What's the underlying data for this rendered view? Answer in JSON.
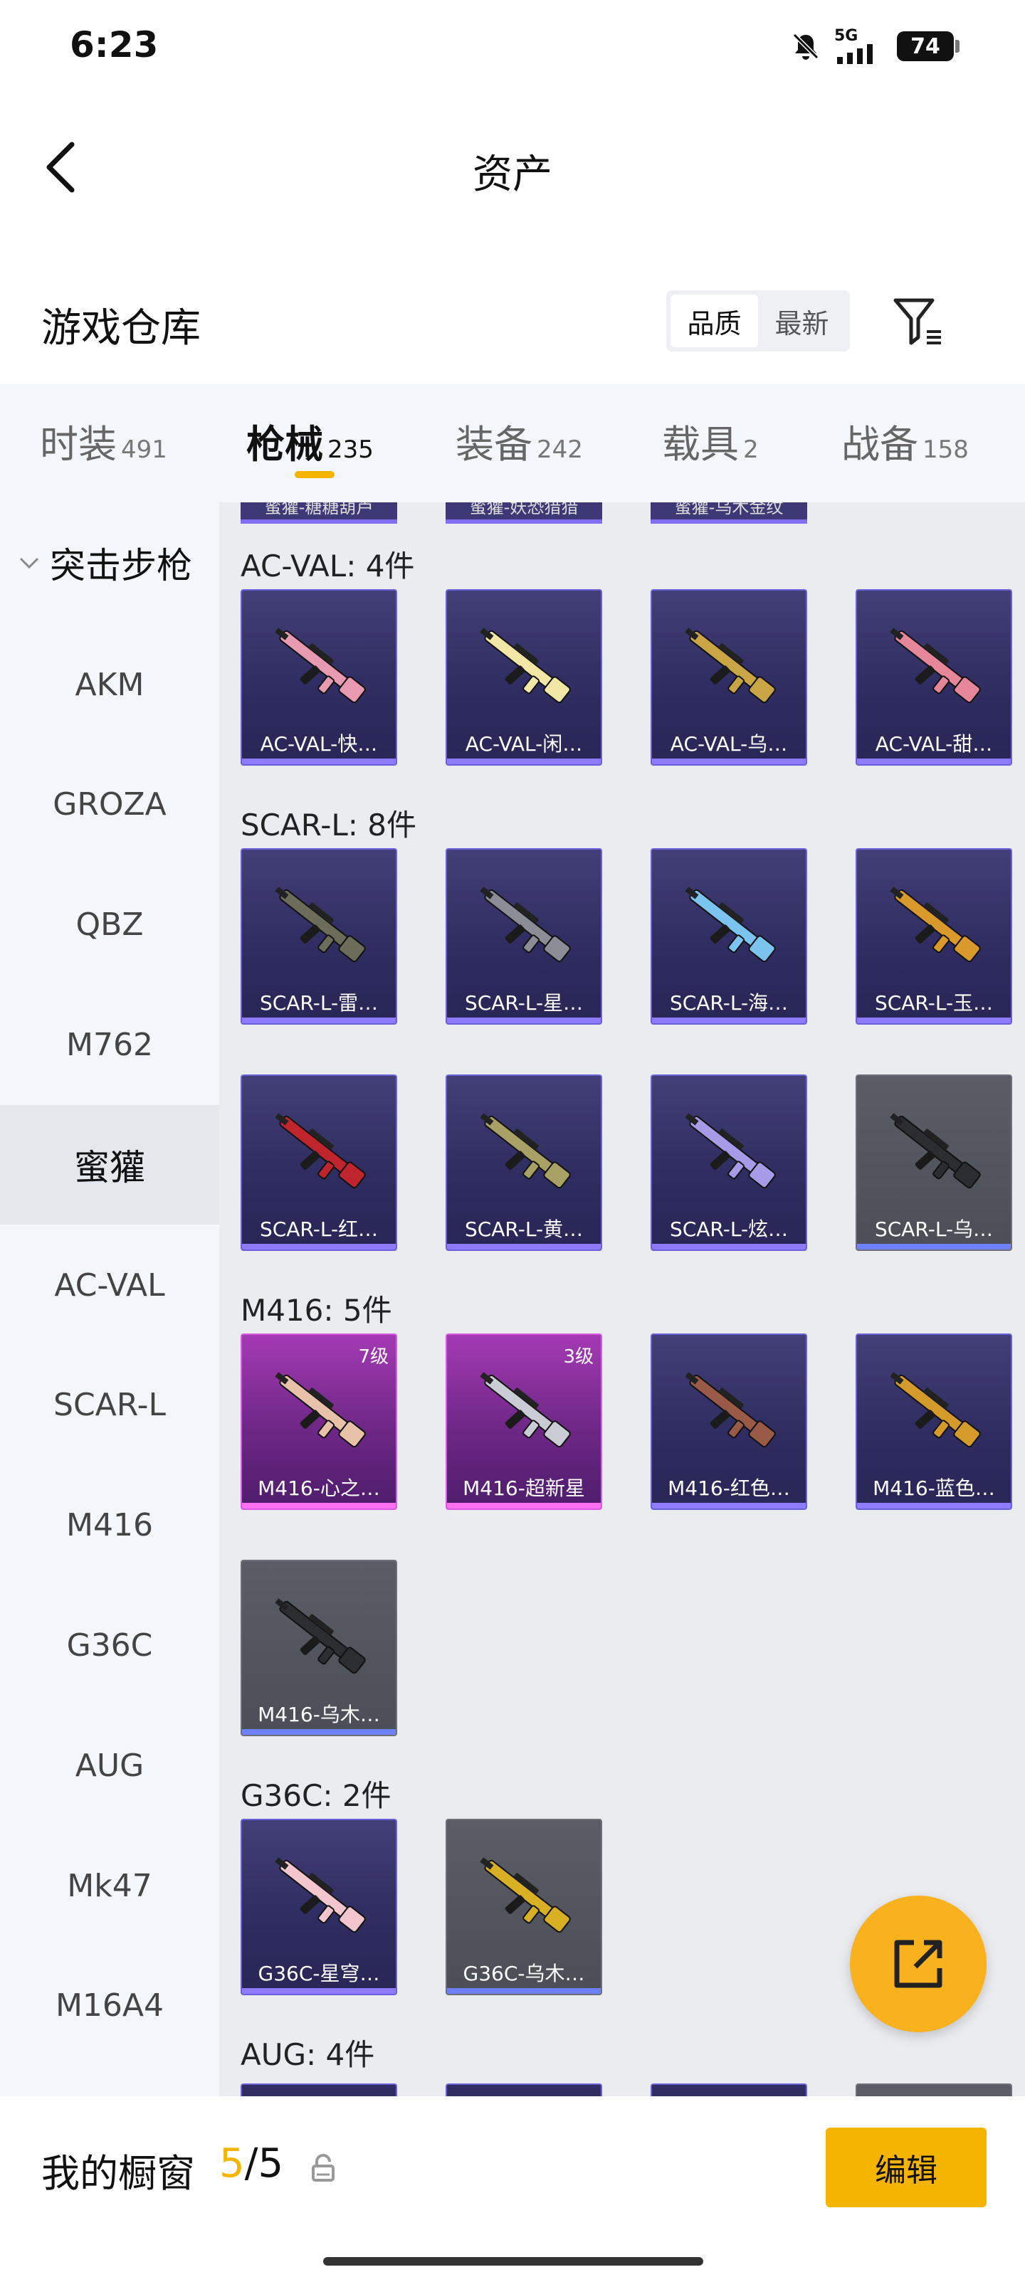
{
  "status_bar": {
    "time": "6:23",
    "network": "5G",
    "battery": "74"
  },
  "header": {
    "title": "资产"
  },
  "warehouse": {
    "title": "游戏仓库",
    "sort_options": [
      "品质",
      "最新"
    ],
    "active_sort": "品质"
  },
  "tabs": [
    {
      "label": "时装",
      "count": "491"
    },
    {
      "label": "枪械",
      "count": "235"
    },
    {
      "label": "装备",
      "count": "242"
    },
    {
      "label": "载具",
      "count": "2"
    },
    {
      "label": "战备",
      "count": "158"
    }
  ],
  "active_tab": "枪械",
  "sidebar": {
    "section": "突击步枪",
    "items": [
      "AKM",
      "GROZA",
      "QBZ",
      "M762",
      "蜜獾",
      "AC-VAL",
      "SCAR-L",
      "M416",
      "G36C",
      "AUG",
      "Mk47",
      "M16A4"
    ],
    "active_item": "蜜獾"
  },
  "partial_top_cards": [
    "蜜獾-糖糖葫芦",
    "蜜獾-妖恐猎猎",
    "蜜獾-乌木金纹"
  ],
  "groups": [
    {
      "label": "AC-VAL: 4件",
      "items": [
        {
          "name": "AC-VAL-快…",
          "tier": "purple",
          "gun_color": "#e79ab0"
        },
        {
          "name": "AC-VAL-闲…",
          "tier": "purple",
          "gun_color": "#f3e7a8"
        },
        {
          "name": "AC-VAL-乌…",
          "tier": "purple",
          "gun_color": "#c9a545"
        },
        {
          "name": "AC-VAL-甜…",
          "tier": "purple",
          "gun_color": "#e6869a"
        }
      ]
    },
    {
      "label": "SCAR-L: 8件",
      "items": [
        {
          "name": "SCAR-L-雷…",
          "tier": "purple",
          "gun_color": "#6b6d5a"
        },
        {
          "name": "SCAR-L-星…",
          "tier": "purple",
          "gun_color": "#8a8d96"
        },
        {
          "name": "SCAR-L-海…",
          "tier": "purple",
          "gun_color": "#7cc4f0"
        },
        {
          "name": "SCAR-L-玉…",
          "tier": "purple",
          "gun_color": "#d99a2b"
        },
        {
          "name": "SCAR-L-红…",
          "tier": "purple",
          "gun_color": "#c0252d"
        },
        {
          "name": "SCAR-L-黄…",
          "tier": "purple",
          "gun_color": "#a8a064"
        },
        {
          "name": "SCAR-L-炫…",
          "tier": "purple",
          "gun_color": "#a79ae6"
        },
        {
          "name": "SCAR-L-乌…",
          "tier": "gray",
          "gun_color": "#2b2d31"
        }
      ]
    },
    {
      "label": "M416: 5件",
      "items": [
        {
          "name": "M416-心之…",
          "tier": "pink",
          "level": "7级",
          "gun_color": "#e8c2a8"
        },
        {
          "name": "M416-超新星",
          "tier": "pink",
          "level": "3级",
          "gun_color": "#c9ccd4"
        },
        {
          "name": "M416-红色…",
          "tier": "purple",
          "gun_color": "#9a5a48"
        },
        {
          "name": "M416-蓝色…",
          "tier": "purple",
          "gun_color": "#d49a2a"
        },
        {
          "name": "M416-乌木…",
          "tier": "gray",
          "gun_color": "#2b2d31"
        }
      ]
    },
    {
      "label": "G36C: 2件",
      "items": [
        {
          "name": "G36C-星穹…",
          "tier": "purple",
          "gun_color": "#f2c6cc"
        },
        {
          "name": "G36C-乌木…",
          "tier": "gray",
          "gun_color": "#d9b024"
        }
      ]
    },
    {
      "label": "AUG: 4件",
      "items": []
    }
  ],
  "bottom_bar": {
    "showcase_label": "我的橱窗",
    "showcase_current": "5",
    "showcase_total": "/5",
    "edit_label": "编辑"
  },
  "colors": {
    "accent": "#f5b400",
    "purple_tier": "#6a60d9",
    "pink_tier": "#d65ae4",
    "gray_tier": "#6d707a"
  }
}
